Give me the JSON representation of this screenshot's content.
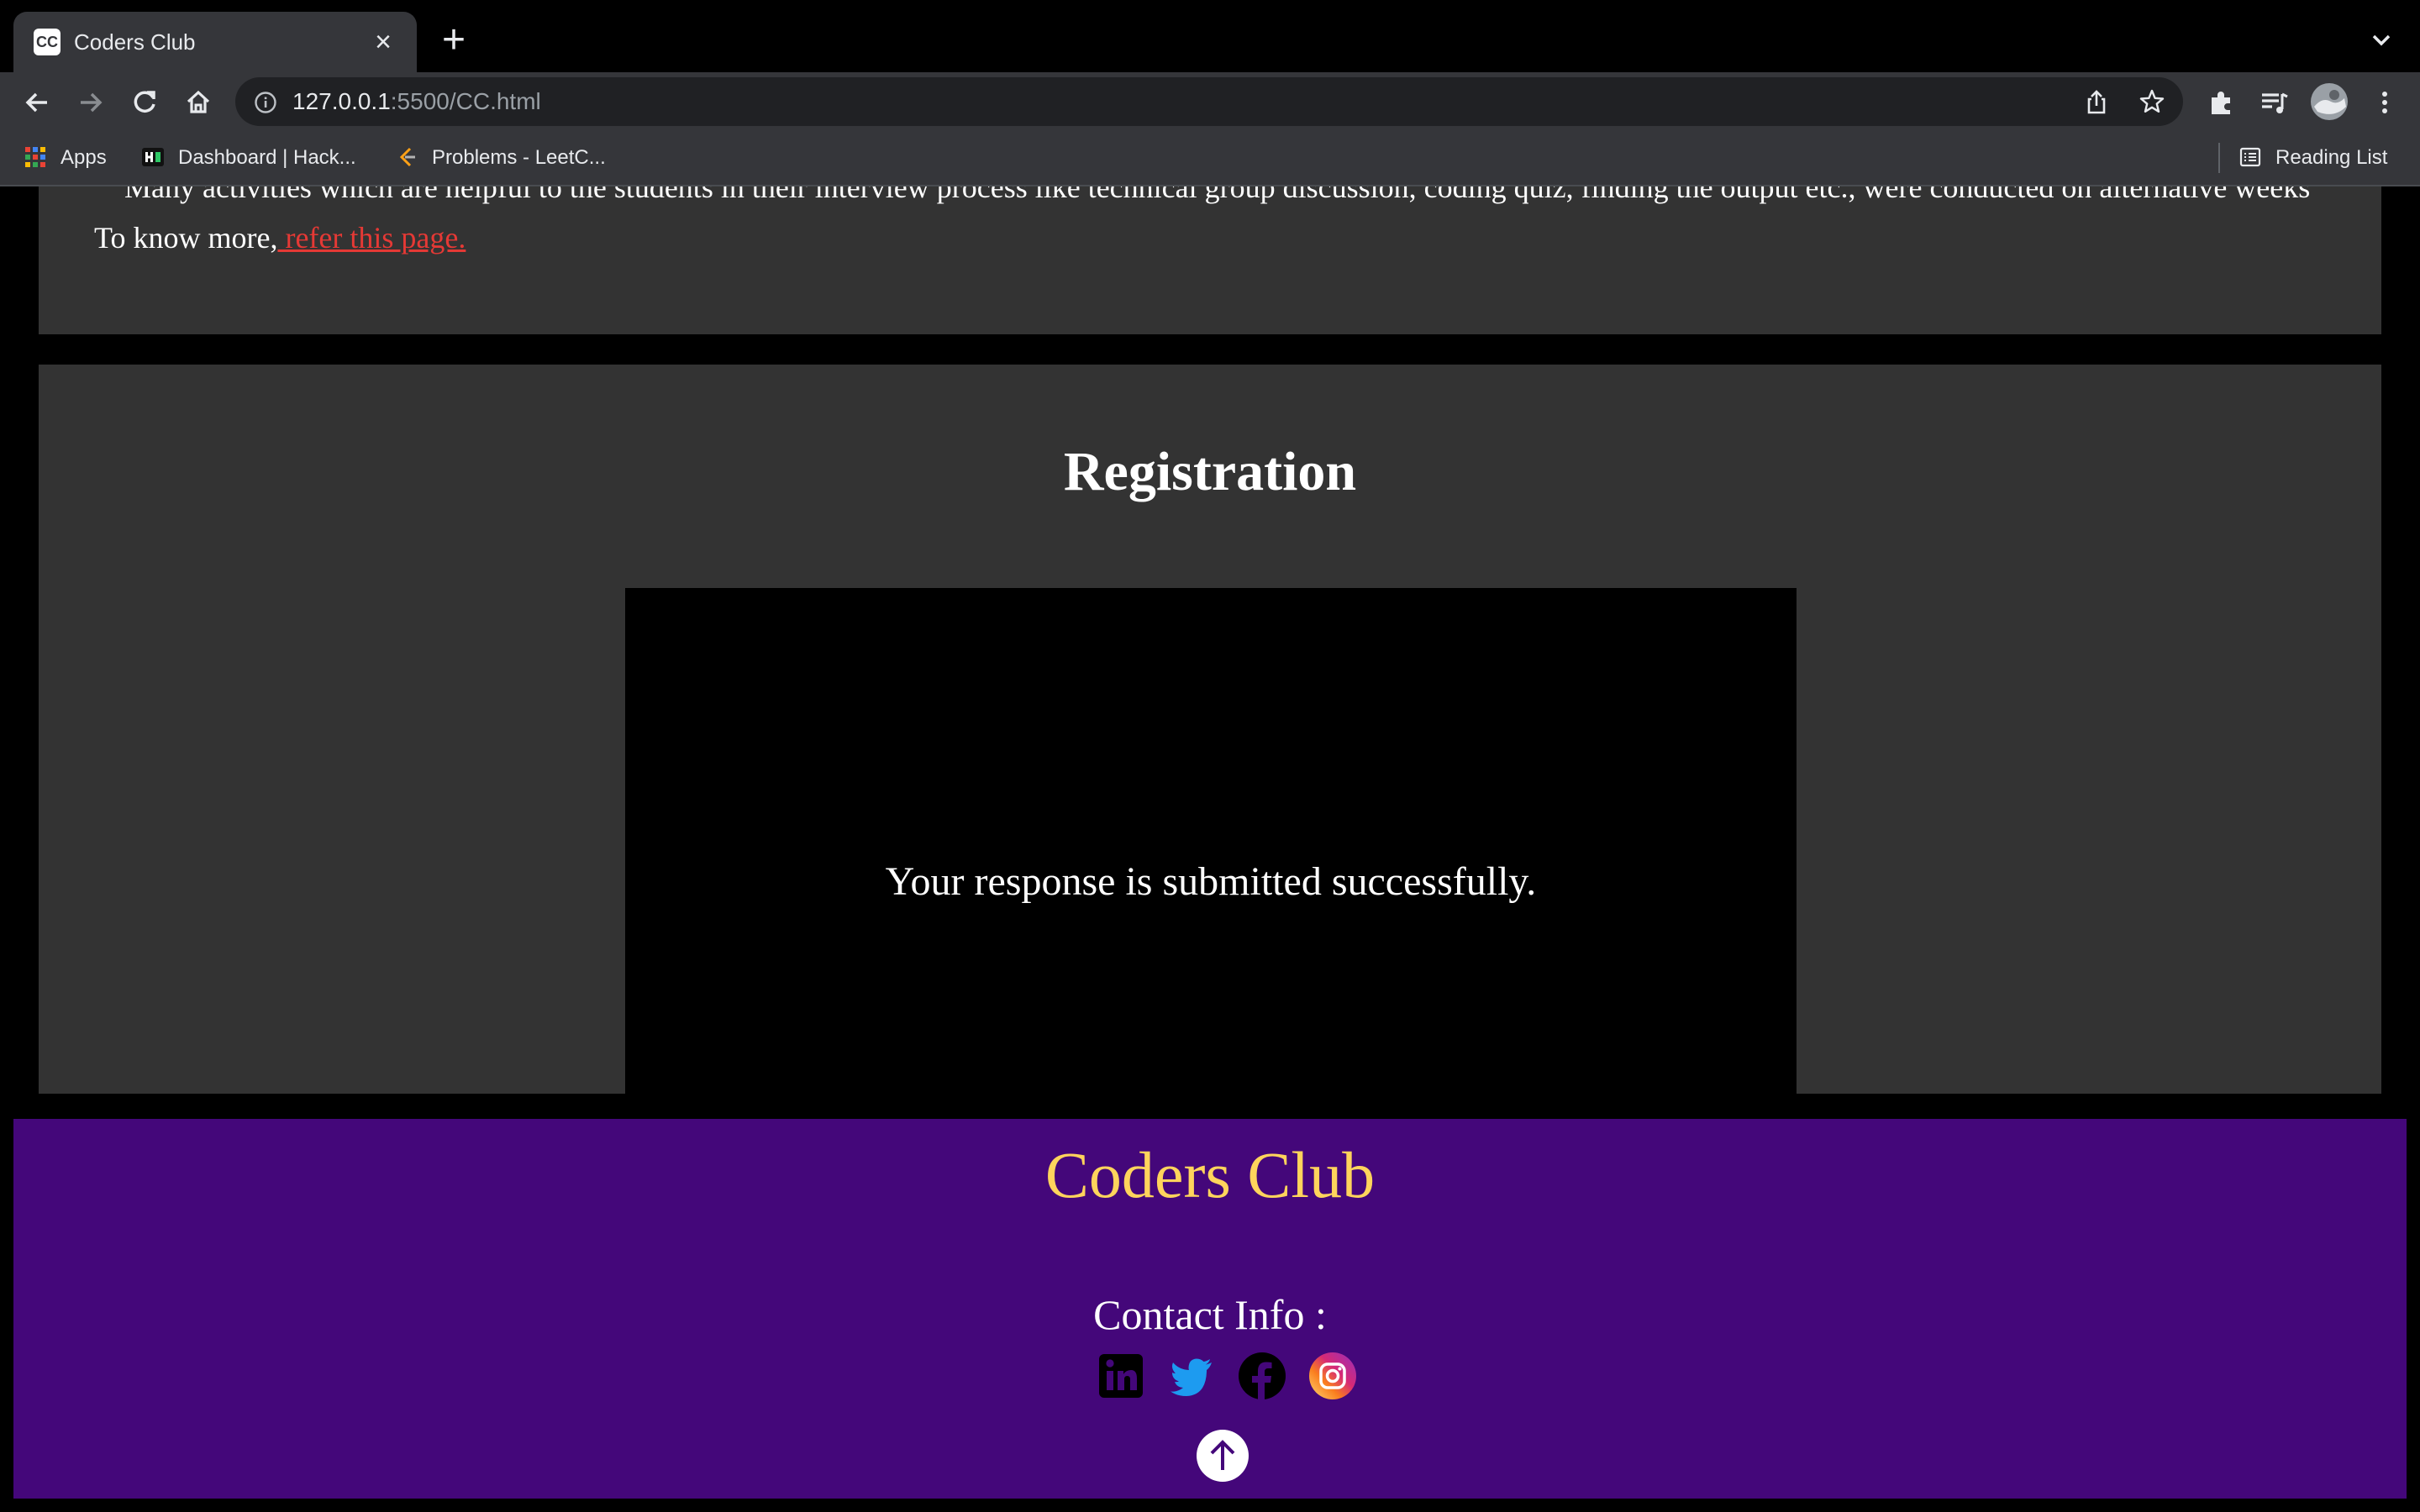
{
  "browser": {
    "tab_title": "Coders Club",
    "tab_favicon_text": "CC",
    "url_host": "127.0.0.1",
    "url_path": ":5500/CC.html",
    "bookmarks": [
      {
        "label": "Apps",
        "icon": "apps-grid-icon"
      },
      {
        "label": "Dashboard | Hack...",
        "icon": "hackerrank-icon"
      },
      {
        "label": "Problems - LeetC...",
        "icon": "leetcode-icon"
      }
    ],
    "reading_list": "Reading List"
  },
  "about": {
    "activities_text": "Many activities which are helpful to the students in their interview process like technical group discussion, coding quiz, finding the output etc., were conducted on alternative weeks",
    "know_more_prefix": "To know more,",
    "refer_link": " refer this page."
  },
  "registration": {
    "title": "Registration",
    "message": "Your response is submitted successfully."
  },
  "footer": {
    "brand": "Coders Club",
    "contact_label": "Contact Info :",
    "socials": [
      "linkedin-icon",
      "twitter-icon",
      "facebook-icon",
      "instagram-icon"
    ]
  },
  "colors": {
    "link": "#e53935",
    "footer_bg": "#44077a",
    "brand": "#ffd45c",
    "section_bg": "#333333"
  }
}
